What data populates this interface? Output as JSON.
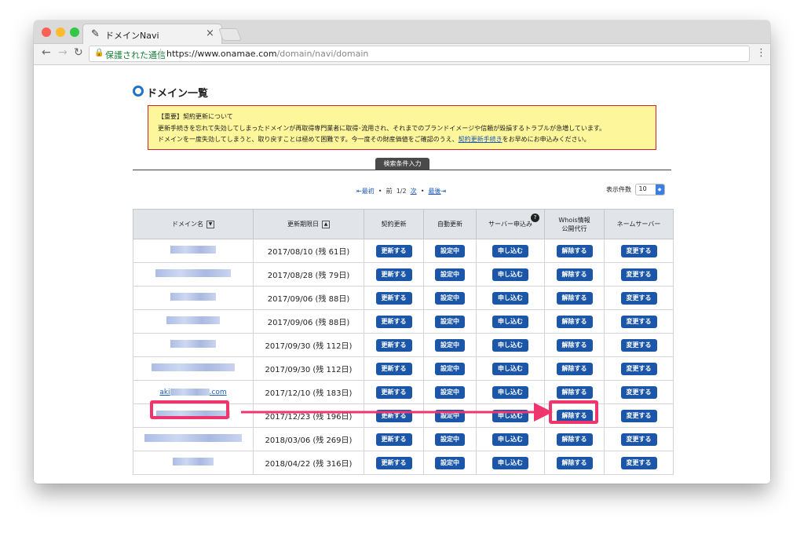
{
  "browser": {
    "tab_title": "ドメインNavi",
    "tab_icon": "bird-logo-icon",
    "close_glyph": "×",
    "secure_label": "保護された通信",
    "url_base": "https://www.onamae.com",
    "url_path": "/domain/navi/domain",
    "colors": {
      "close": "#fc5f57",
      "minimize": "#fdbc2e",
      "maximize": "#33c748"
    }
  },
  "page": {
    "title": "ドメイン一覧",
    "notice": {
      "heading": "【重要】契約更新について",
      "line1": "更新手続きを忘れて失効してしまったドメインが再取得専門業者に取得･流用され、それまでのブランドイメージや信頼が毀損するトラブルが急増しています。",
      "line2_prefix": "ドメインを一度失効してしまうと、取り戻すことは極めて困難です。今一度その財産価値をご確認のうえ、",
      "line2_link": "契約更新手続き",
      "line2_suffix": "をお早めにお申込みください。"
    },
    "search_tab": "検索条件入力",
    "pager": {
      "first": "最初",
      "prev": "前",
      "current": "1/2",
      "next": "次",
      "last": "最後"
    },
    "per_page_label": "表示件数",
    "per_page_value": "10"
  },
  "table": {
    "headers": {
      "domain": "ドメイン名",
      "expiry": "更新期限日",
      "renew": "契約更新",
      "auto": "自動更新",
      "server": "サーバー申込み",
      "whois1": "Whois情報",
      "whois2": "公開代行",
      "ns": "ネームサーバー"
    },
    "sort_down_glyph": "▼",
    "sort_up_glyph": "▲",
    "help_glyph": "?",
    "buttons": {
      "renew": "更新する",
      "auto": "設定中",
      "server": "申し込む",
      "whois": "解除する",
      "ns": "変更する"
    },
    "rows": [
      {
        "domain_visible": "",
        "expiry": "2017/08/10 (残 61日)"
      },
      {
        "domain_visible": "",
        "expiry": "2017/08/28 (残 79日)"
      },
      {
        "domain_visible": "",
        "expiry": "2017/09/06 (残 88日)"
      },
      {
        "domain_visible": "",
        "expiry": "2017/09/06 (残 88日)"
      },
      {
        "domain_visible": "",
        "expiry": "2017/09/30 (残 112日)"
      },
      {
        "domain_visible": "",
        "expiry": "2017/09/30 (残 112日)"
      },
      {
        "domain_prefix": "aki",
        "domain_suffix": ".com",
        "expiry": "2017/12/10 (残 183日)",
        "highlighted": true
      },
      {
        "domain_visible": "",
        "expiry": "2017/12/23 (残 196日)"
      },
      {
        "domain_visible": "",
        "expiry": "2018/03/06 (残 269日)"
      },
      {
        "domain_visible": "",
        "expiry": "2018/04/22 (残 316日)"
      }
    ]
  },
  "annotation": {
    "color": "#f0356e"
  }
}
